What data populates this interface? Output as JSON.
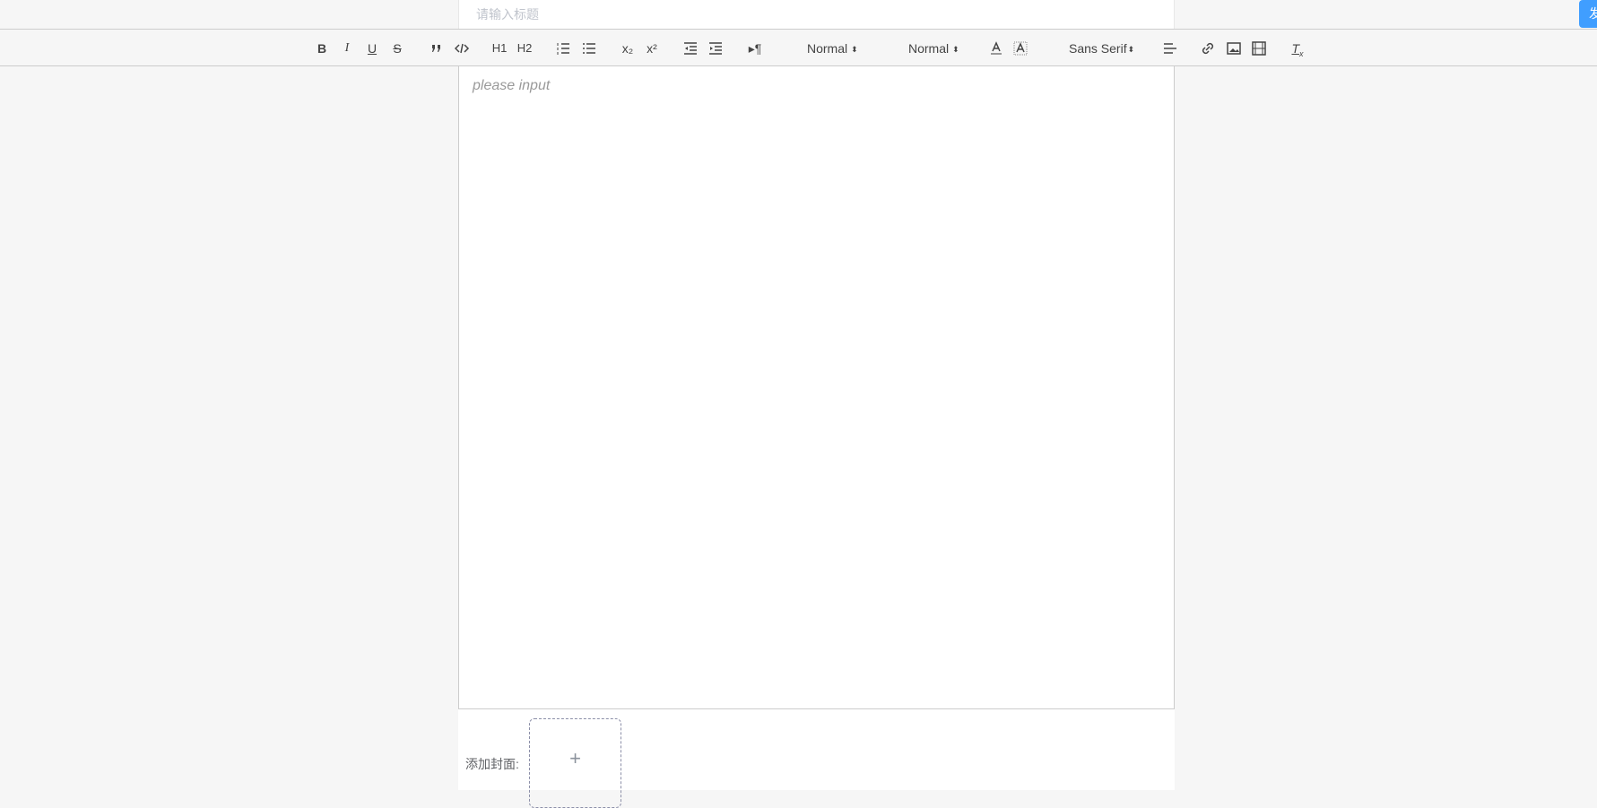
{
  "title": {
    "placeholder": "请输入标题",
    "value": ""
  },
  "publish_button": {
    "label": "发布",
    "color": "#409eff"
  },
  "toolbar": {
    "buttons": {
      "bold": "B",
      "italic": "I",
      "underline": "U",
      "strike": "S",
      "h1": "H1",
      "h2": "H2",
      "sub": "x₂",
      "sup": "x²",
      "direction": "▸¶"
    },
    "size_select": "Normal",
    "header_select": "Normal",
    "font_select": "Sans Serif",
    "arrow": "⬍"
  },
  "editor": {
    "placeholder": "please input"
  },
  "cover": {
    "label": "添加封面:",
    "plus": "+"
  }
}
